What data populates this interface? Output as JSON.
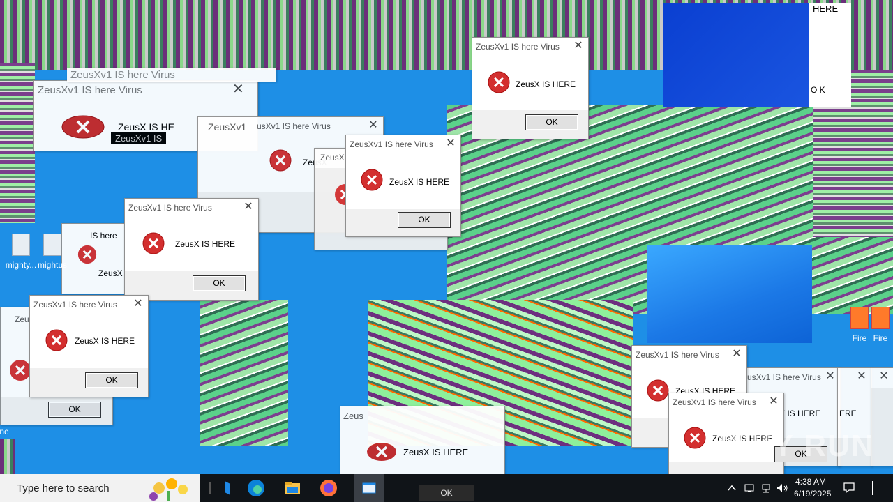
{
  "dialog": {
    "title": "ZeusXv1 IS here Virus",
    "message": "ZeusX IS HERE",
    "ok_label": "OK"
  },
  "ghost_titles": {
    "large_top": "ZeusXv1 IS here Virus",
    "large_second": "ZeusXv1 IS here Virus",
    "short": "ZeusXv1",
    "mid": "usXv1 IS here Virus",
    "partial": "Zeus",
    "partial2": "ZeusX",
    "big_msg": "ZeusX IS HE",
    "black_tag": "ZeusXv1 IS",
    "bottom_msg": "ZeusX IS HERE",
    "frag_here": "HERE",
    "frag_ok": "O K",
    "frag_x_here": "X IS HERE",
    "frag_ere": "ERE",
    "frag_zeus_here": "ZeusX IS HERE",
    "frag_ishere": "IS here",
    "frag_zeusx_title": "ZeusXv1 IS here Virus",
    "frag_zeux": "ZeusX",
    "frag_s": "s"
  },
  "desktop_icons": [
    {
      "label": "mighty..."
    },
    {
      "label": "mightus"
    },
    {
      "label": "Fire"
    },
    {
      "label": "Fire"
    },
    {
      "label": "ne"
    }
  ],
  "taskbar": {
    "search_placeholder": "Type here to search",
    "time": "4:38 AM",
    "date": "6/19/2025"
  },
  "watermark": "ANY RUN",
  "colors": {
    "error_red": "#d32f2f",
    "desktop_blue": "#1e8fe6",
    "taskbar": "#101418"
  }
}
